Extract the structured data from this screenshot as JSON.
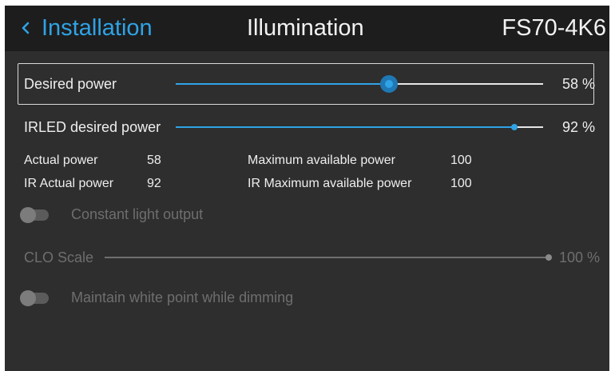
{
  "header": {
    "back_label": "Installation",
    "title": "Illumination",
    "model": "FS70-4K6"
  },
  "desired_power": {
    "label": "Desired power",
    "value_text": "58 %",
    "value": 58
  },
  "irled_power": {
    "label": "IRLED desired power",
    "value_text": "92 %",
    "value": 92
  },
  "stats": {
    "actual_power_label": "Actual power",
    "actual_power_value": "58",
    "ir_actual_power_label": "IR Actual power",
    "ir_actual_power_value": "92",
    "max_power_label": "Maximum available power",
    "max_power_value": "100",
    "ir_max_power_label": "IR Maximum available power",
    "ir_max_power_value": "100"
  },
  "constant_light": {
    "label": "Constant light output",
    "enabled": false
  },
  "clo_scale": {
    "label": "CLO Scale",
    "value_text": "100 %",
    "value": 100
  },
  "white_point": {
    "label": "Maintain white point while dimming",
    "enabled": false
  },
  "colors": {
    "accent": "#2fa3e6",
    "background": "#2e2e2e",
    "header_background": "#1d1d1d"
  }
}
